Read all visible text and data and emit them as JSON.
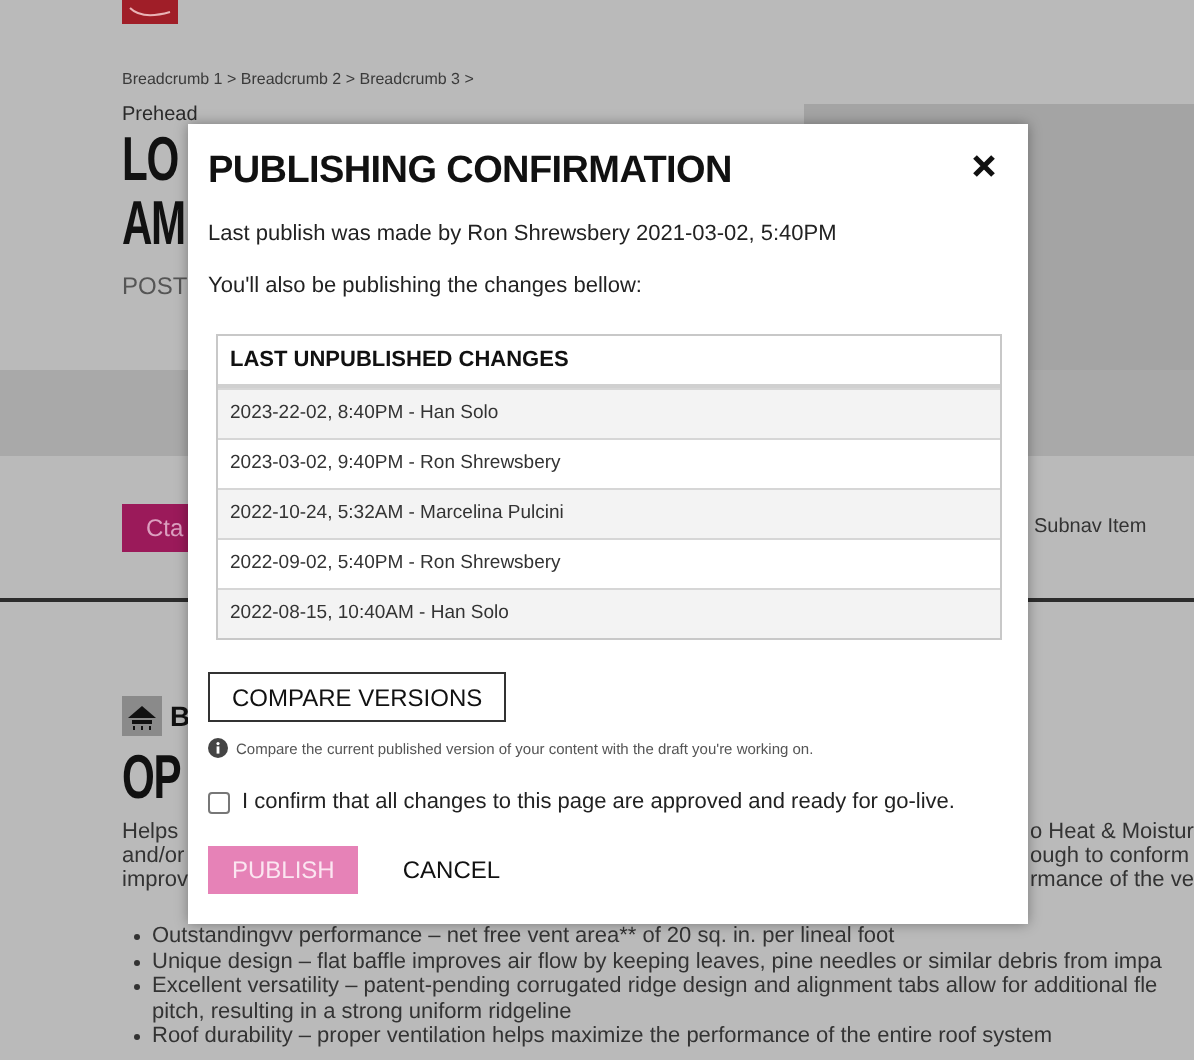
{
  "background": {
    "breadcrumb": "Breadcrumb 1 > Breadcrumb 2 > Breadcrumb 3 >",
    "prehead": "Prehead",
    "title_lines": [
      "LO",
      "AM"
    ],
    "post": "POST",
    "cta": "Cta",
    "subnav_item": "Subnav Item",
    "section_label": "B",
    "section_title": "OP",
    "paragraph": [
      {
        "left": "Helps",
        "right": "o Heat & Moistur"
      },
      {
        "left": "and/or",
        "right": "ough to conform"
      },
      {
        "left": "improv",
        "right": "rmance of the ve"
      }
    ],
    "bullets": [
      {
        "lines": [
          "Outstandingvv performance – net free vent area** of 20 sq. in. per lineal foot"
        ]
      },
      {
        "lines": [
          "Unique design – flat baffle improves air flow by keeping leaves, pine needles or similar debris from impa"
        ]
      },
      {
        "lines": [
          "Excellent versatility – patent-pending corrugated ridge design and alignment tabs allow for additional fle",
          "pitch, resulting in a strong uniform ridgeline"
        ]
      },
      {
        "lines": [
          "Roof durability – proper ventilation helps maximize the performance of the entire roof system"
        ]
      }
    ]
  },
  "dialog": {
    "title": "PUBLISHING CONFIRMATION",
    "last_publish": "Last publish was made by Ron Shrewsbery 2021-03-02, 5:40PM",
    "intro": "You'll also be publishing the changes bellow:",
    "table": {
      "header": "LAST UNPUBLISHED CHANGES",
      "rows": [
        "2023-22-02, 8:40PM - Han Solo",
        "2023-03-02, 9:40PM - Ron Shrewsbery",
        "2022-10-24, 5:32AM - Marcelina Pulcini",
        "2022-09-02, 5:40PM - Ron Shrewsbery",
        "2022-08-15, 10:40AM - Han Solo"
      ]
    },
    "compare_button": "COMPARE VERSIONS",
    "compare_hint": "Compare the current published version of your content with the draft you're working on.",
    "confirm": {
      "label": "I confirm that all changes to this page are approved and ready for go-live.",
      "checked": false
    },
    "publish": {
      "label": "PUBLISH",
      "disabled": true
    },
    "cancel": "CANCEL"
  }
}
